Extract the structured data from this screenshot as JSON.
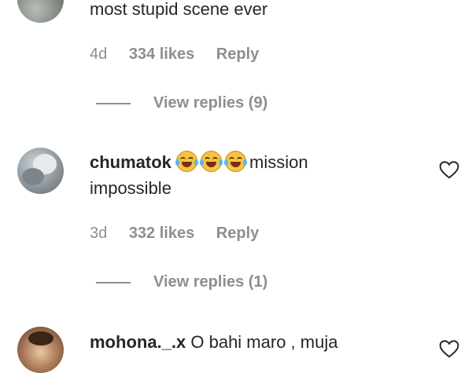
{
  "comments": [
    {
      "username": "",
      "text": "most stupid scene ever",
      "age": "4d",
      "likes": "334 likes",
      "reply_label": "Reply",
      "view_replies": "View replies (9)"
    },
    {
      "username": "chumatok",
      "emojis": [
        "face-with-tears-of-joy",
        "face-with-tears-of-joy",
        "face-with-tears-of-joy"
      ],
      "text_line1": "mission",
      "text_line2": "impossible",
      "age": "3d",
      "likes": "332 likes",
      "reply_label": "Reply",
      "view_replies": "View replies (1)"
    },
    {
      "username": "mohona._.x",
      "text": "O bahi maro , muja"
    }
  ],
  "colors": {
    "text": "#262626",
    "secondary": "#8e8e8e",
    "background": "#ffffff"
  },
  "icons": {
    "like": "heart-outline-icon"
  }
}
